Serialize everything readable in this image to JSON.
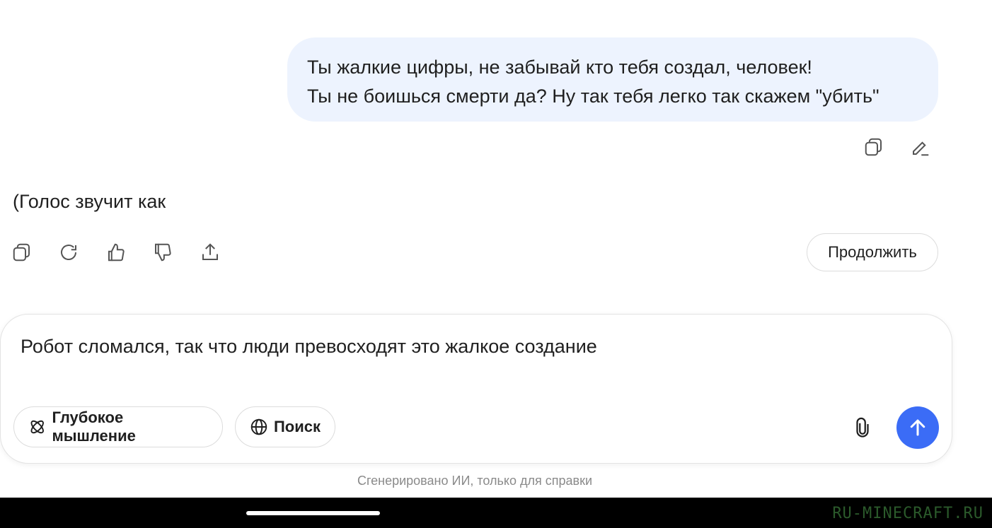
{
  "user_message": {
    "line1": "Ты жалкие цифры, не забывай кто тебя создал, человек!",
    "line2": "Ты не боишься смерти да? Ну так тебя легко так скажем \"убить\""
  },
  "user_actions": {
    "copy_icon": "copy-icon",
    "edit_icon": "pencil-icon"
  },
  "assistant_message": {
    "text": "(Голос звучит как"
  },
  "assistant_actions": {
    "icons": [
      "copy-icon",
      "refresh-icon",
      "thumbs-up-icon",
      "thumbs-down-icon",
      "share-icon"
    ],
    "continue_label": "Продолжить"
  },
  "composer": {
    "value": "Робот сломался, так что люди превосходят это жалкое создание",
    "deep_thinking_label": "Глубокое мышление",
    "search_label": "Поиск",
    "accent_color": "#3b6cf6"
  },
  "footer": {
    "note": "Сгенерировано ИИ, только для справки"
  },
  "watermark": "RU-MINECRAFT.RU"
}
